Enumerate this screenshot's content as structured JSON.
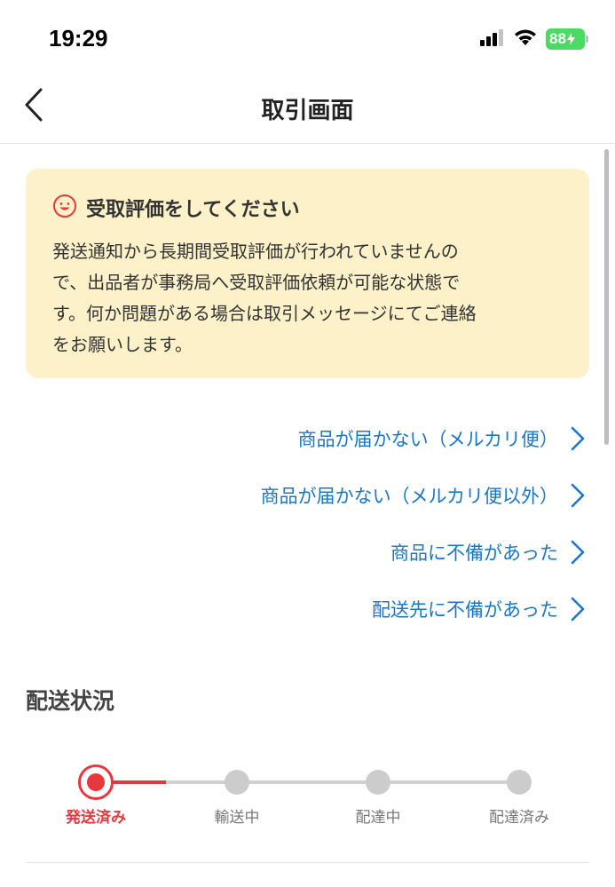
{
  "status_bar": {
    "time": "19:29",
    "battery": "88",
    "icons": [
      "signal-icon",
      "wifi-icon",
      "battery-icon"
    ]
  },
  "nav": {
    "title": "取引画面",
    "back_icon": "chevron-left-icon"
  },
  "notice": {
    "icon": "smiley-face-icon",
    "title": "受取評価をしてください",
    "body_lines": [
      "発送通知から長期間受取評価が行われていませんの",
      "で、出品者が事務局へ受取評価依頼が可能な状態で",
      "す。何か問題がある場合は取引メッセージにてご連絡",
      "をお願いします。"
    ],
    "background": "#fdf1c9"
  },
  "links": [
    {
      "label": "商品が届かない（メルカリ便）"
    },
    {
      "label": "商品が届かない（メルカリ便以外）"
    },
    {
      "label": "商品に不備があった"
    },
    {
      "label": "配送先に不備があった"
    }
  ],
  "delivery": {
    "section_title": "配送状況",
    "steps": [
      "発送済み",
      "輸送中",
      "配達中",
      "配達済み"
    ],
    "current_step": 0,
    "active_color": "#e8383d",
    "inactive_color": "#cccccc"
  },
  "colors": {
    "link": "#1b76c8",
    "accent": "#e8383d"
  }
}
